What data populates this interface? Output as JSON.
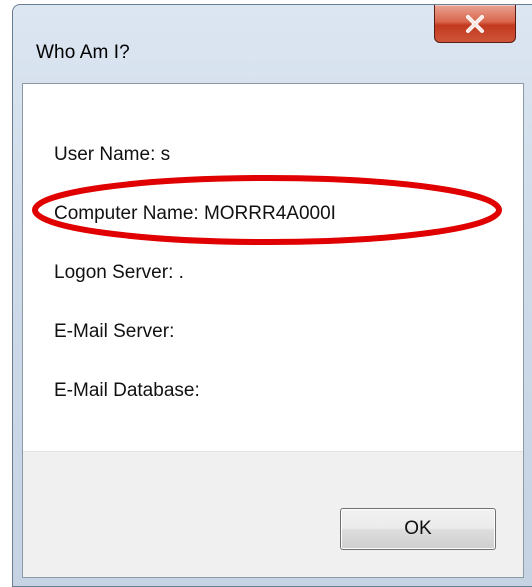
{
  "window": {
    "title": "Who Am I?",
    "close_icon": "close-icon"
  },
  "info": {
    "user_name_label": "User Name:",
    "user_name_value": "s",
    "computer_name_label": "Computer Name:",
    "computer_name_value": "MORRR4A000I",
    "logon_server_label": "Logon Server:",
    "logon_server_value": ".",
    "email_server_label": "E-Mail Server:",
    "email_server_value": "",
    "email_database_label": "E-Mail Database:",
    "email_database_value": ""
  },
  "footer": {
    "ok_label": "OK"
  },
  "annotation": {
    "shape": "ellipse",
    "color": "#e00000",
    "target": "computer-name-line"
  },
  "colors": {
    "close_button_red": "#c1391f",
    "frame_blue": "#cfdbe9"
  }
}
